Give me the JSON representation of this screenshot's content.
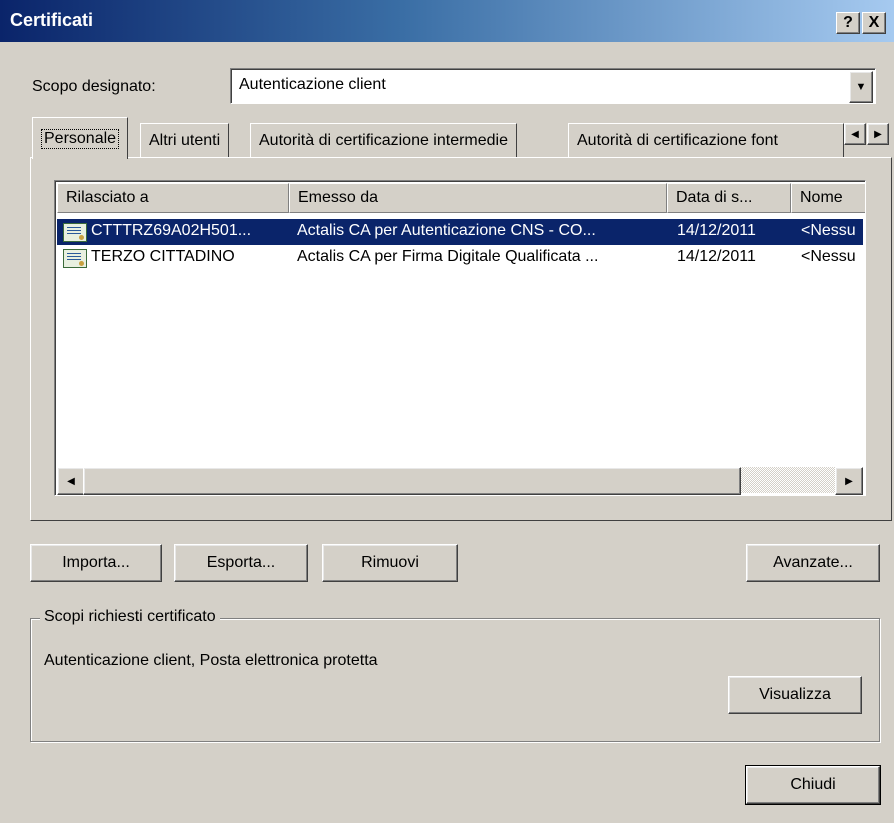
{
  "window": {
    "title": "Certificati",
    "help_label": "?",
    "close_label": "X"
  },
  "purpose": {
    "label": "Scopo designato:",
    "value": "Autenticazione client",
    "dropdown_glyph": "▼"
  },
  "tabs": [
    {
      "label": "Personale",
      "active": true
    },
    {
      "label": "Altri utenti"
    },
    {
      "label": "Autorità di certificazione intermedie"
    },
    {
      "label": "Autorità di certificazione font"
    }
  ],
  "tab_scroll": {
    "left_glyph": "◀",
    "right_glyph": "▶"
  },
  "list": {
    "columns": [
      "Rilasciato a",
      "Emesso da",
      "Data di s...",
      "Nome"
    ],
    "rows": [
      {
        "issued_to": "CTTTRZ69A02H501...",
        "issued_by": "Actalis CA per Autenticazione CNS - CO...",
        "date": "14/12/2011",
        "name": "<Nessu",
        "selected": true
      },
      {
        "issued_to": "TERZO CITTADINO",
        "issued_by": "Actalis CA per Firma Digitale Qualificata ...",
        "date": "14/12/2011",
        "name": "<Nessu",
        "selected": false
      }
    ],
    "scroll_left_glyph": "◀",
    "scroll_right_glyph": "▶"
  },
  "buttons": {
    "import": "Importa...",
    "export": "Esporta...",
    "remove": "Rimuovi",
    "advanced": "Avanzate...",
    "view": "Visualizza",
    "close": "Chiudi"
  },
  "purposes_group": {
    "legend": "Scopi richiesti certificato",
    "text": "Autenticazione client, Posta elettronica protetta"
  },
  "colors": {
    "titlebar_start": "#0a246a",
    "titlebar_end": "#a6caf0",
    "selection": "#0a246a",
    "face": "#d4d0c8"
  }
}
